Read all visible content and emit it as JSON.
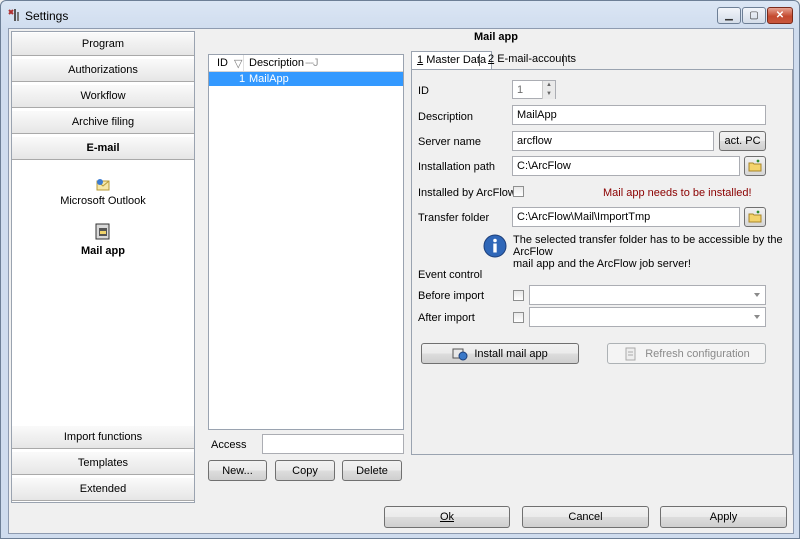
{
  "window": {
    "title": "Settings"
  },
  "nav": {
    "top_items": [
      {
        "label": "Program"
      },
      {
        "label": "Authorizations"
      },
      {
        "label": "Workflow"
      },
      {
        "label": "Archive filing"
      },
      {
        "label": "E-mail"
      }
    ],
    "sub_items": [
      {
        "label": "Microsoft Outlook",
        "icon": "outlook-icon"
      },
      {
        "label": "Mail app",
        "icon": "mail-app-icon"
      }
    ],
    "bottom_items": [
      {
        "label": "Import functions"
      },
      {
        "label": "Templates"
      },
      {
        "label": "Extended"
      }
    ]
  },
  "header": {
    "title": "Mail app"
  },
  "list": {
    "columns": [
      "ID",
      "Description"
    ],
    "rows": [
      {
        "id": "1",
        "description": "MailApp"
      }
    ],
    "access_label": "Access",
    "access_value": "",
    "new_label": "New...",
    "copy_label": "Copy",
    "delete_label": "Delete"
  },
  "tabs": [
    {
      "key": "1",
      "label": "Master Data"
    },
    {
      "key": "2",
      "label": "E-mail-accounts"
    }
  ],
  "form": {
    "id_label": "ID",
    "id_value": "1",
    "description_label": "Description",
    "description_value": "MailApp",
    "server_label": "Server name",
    "server_value": "arcflow",
    "act_pc_label": "act. PC",
    "install_path_label": "Installation path",
    "install_path_value": "C:\\ArcFlow",
    "installed_label": "Installed by ArcFlow",
    "installed_warning": "Mail app needs to be installed!",
    "transfer_label": "Transfer folder",
    "transfer_value": "C:\\ArcFlow\\Mail\\ImportTmp",
    "info_line1": "The selected transfer folder has to be accessible by the ArcFlow",
    "info_line2": "mail app and the ArcFlow job server!",
    "event_control_label": "Event control",
    "before_import_label": "Before import",
    "after_import_label": "After import",
    "install_button_label": "Install mail app",
    "refresh_button_label": "Refresh configuration"
  },
  "footer": {
    "ok_label": "Ok",
    "cancel_label": "Cancel",
    "apply_label": "Apply"
  }
}
